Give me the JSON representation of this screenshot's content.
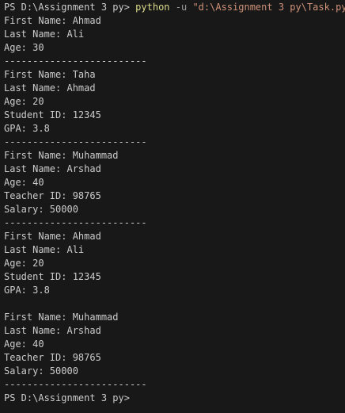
{
  "terminal": {
    "prompt": "PS D:\\Assignment 3 py> ",
    "command": {
      "program": "python",
      "flag": "-u",
      "path": "\"d:\\Assignment 3 py\\Task.py\""
    },
    "output": [
      "First Name: Ahmad",
      "Last Name: Ali",
      "Age: 30",
      "-------------------------",
      "First Name: Taha",
      "Last Name: Ahmad",
      "Age: 20",
      "Student ID: 12345",
      "GPA: 3.8",
      "-------------------------",
      "First Name: Muhammad",
      "Last Name: Arshad",
      "Age: 40",
      "Teacher ID: 98765",
      "Salary: 50000",
      "-------------------------",
      "First Name: Ahmad",
      "Last Name: Ali",
      "Age: 20",
      "Student ID: 12345",
      "GPA: 3.8",
      "",
      "First Name: Muhammad",
      "Last Name: Arshad",
      "Age: 40",
      "Teacher ID: 98765",
      "Salary: 50000",
      "-------------------------"
    ],
    "final_prompt": "PS D:\\Assignment 3 py>"
  },
  "colors": {
    "background": "#181818",
    "text": "#cccccc",
    "command": "#dcdc8b",
    "flag": "#9d9d9d",
    "string": "#ce9178"
  }
}
